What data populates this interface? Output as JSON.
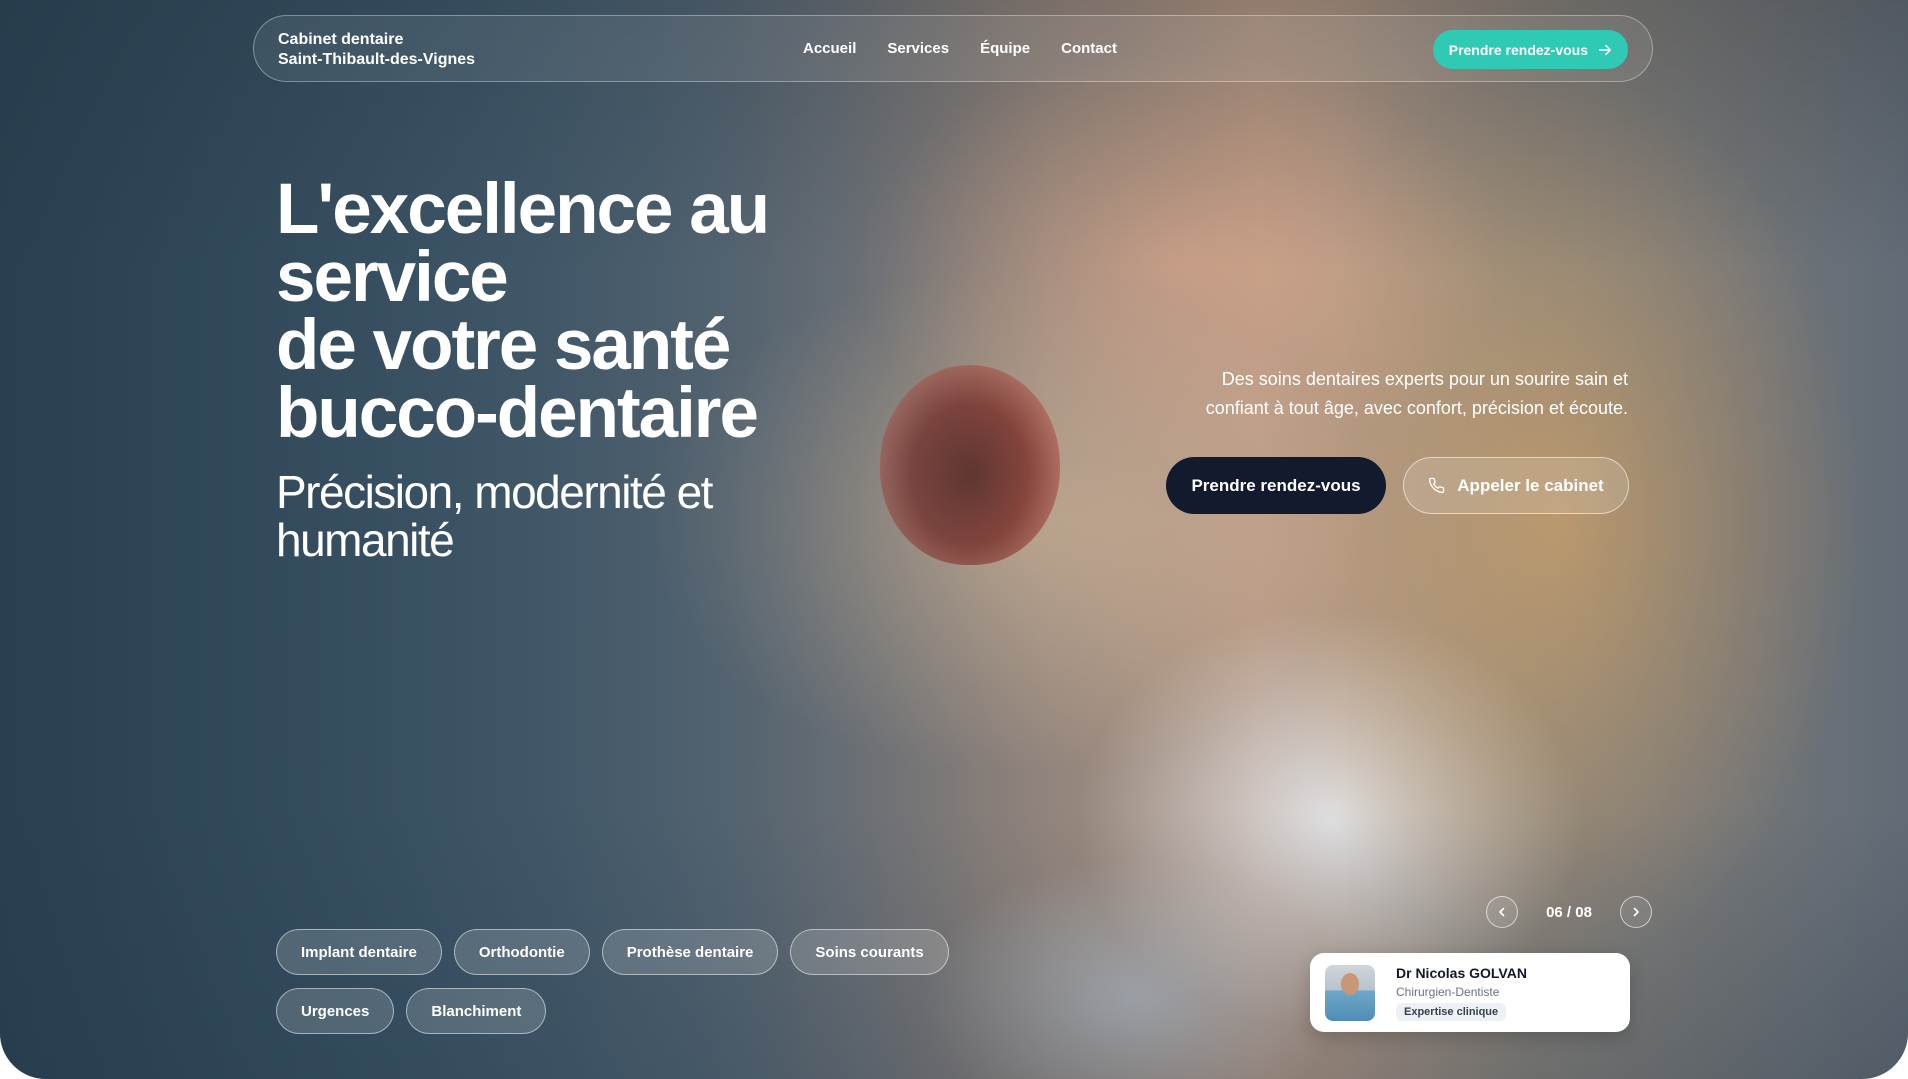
{
  "header": {
    "brand_line1": "Cabinet dentaire",
    "brand_line2": "Saint-Thibault-des-Vignes",
    "nav": [
      "Accueil",
      "Services",
      "Équipe",
      "Contact"
    ],
    "cta_label": "Prendre rendez-vous",
    "cta_color": "#2fc9b4"
  },
  "hero": {
    "headline_lines": [
      "L'excellence au",
      "service",
      "de votre santé",
      "bucco-dentaire"
    ],
    "subheadline_line1": "Précision, modernité et",
    "subheadline_line2": "humanité",
    "description_line1": "Des soins dentaires experts pour un sourire sain et",
    "description_line2": "confiant à tout âge, avec confort, précision et écoute.",
    "primary_button": "Prendre rendez-vous",
    "call_button": "Appeler le cabinet",
    "primary_button_color": "#121a2e"
  },
  "services_tags": [
    "Implant dentaire",
    "Orthodontie",
    "Prothèse dentaire",
    "Soins courants",
    "Urgences",
    "Blanchiment"
  ],
  "pager": {
    "counter": "06 / 08",
    "prev_icon": "chevron-left-icon",
    "next_icon": "chevron-right-icon"
  },
  "doctor_card": {
    "name": "Dr Nicolas GOLVAN",
    "role": "Chirurgien-Dentiste",
    "badge": "Expertise clinique"
  }
}
